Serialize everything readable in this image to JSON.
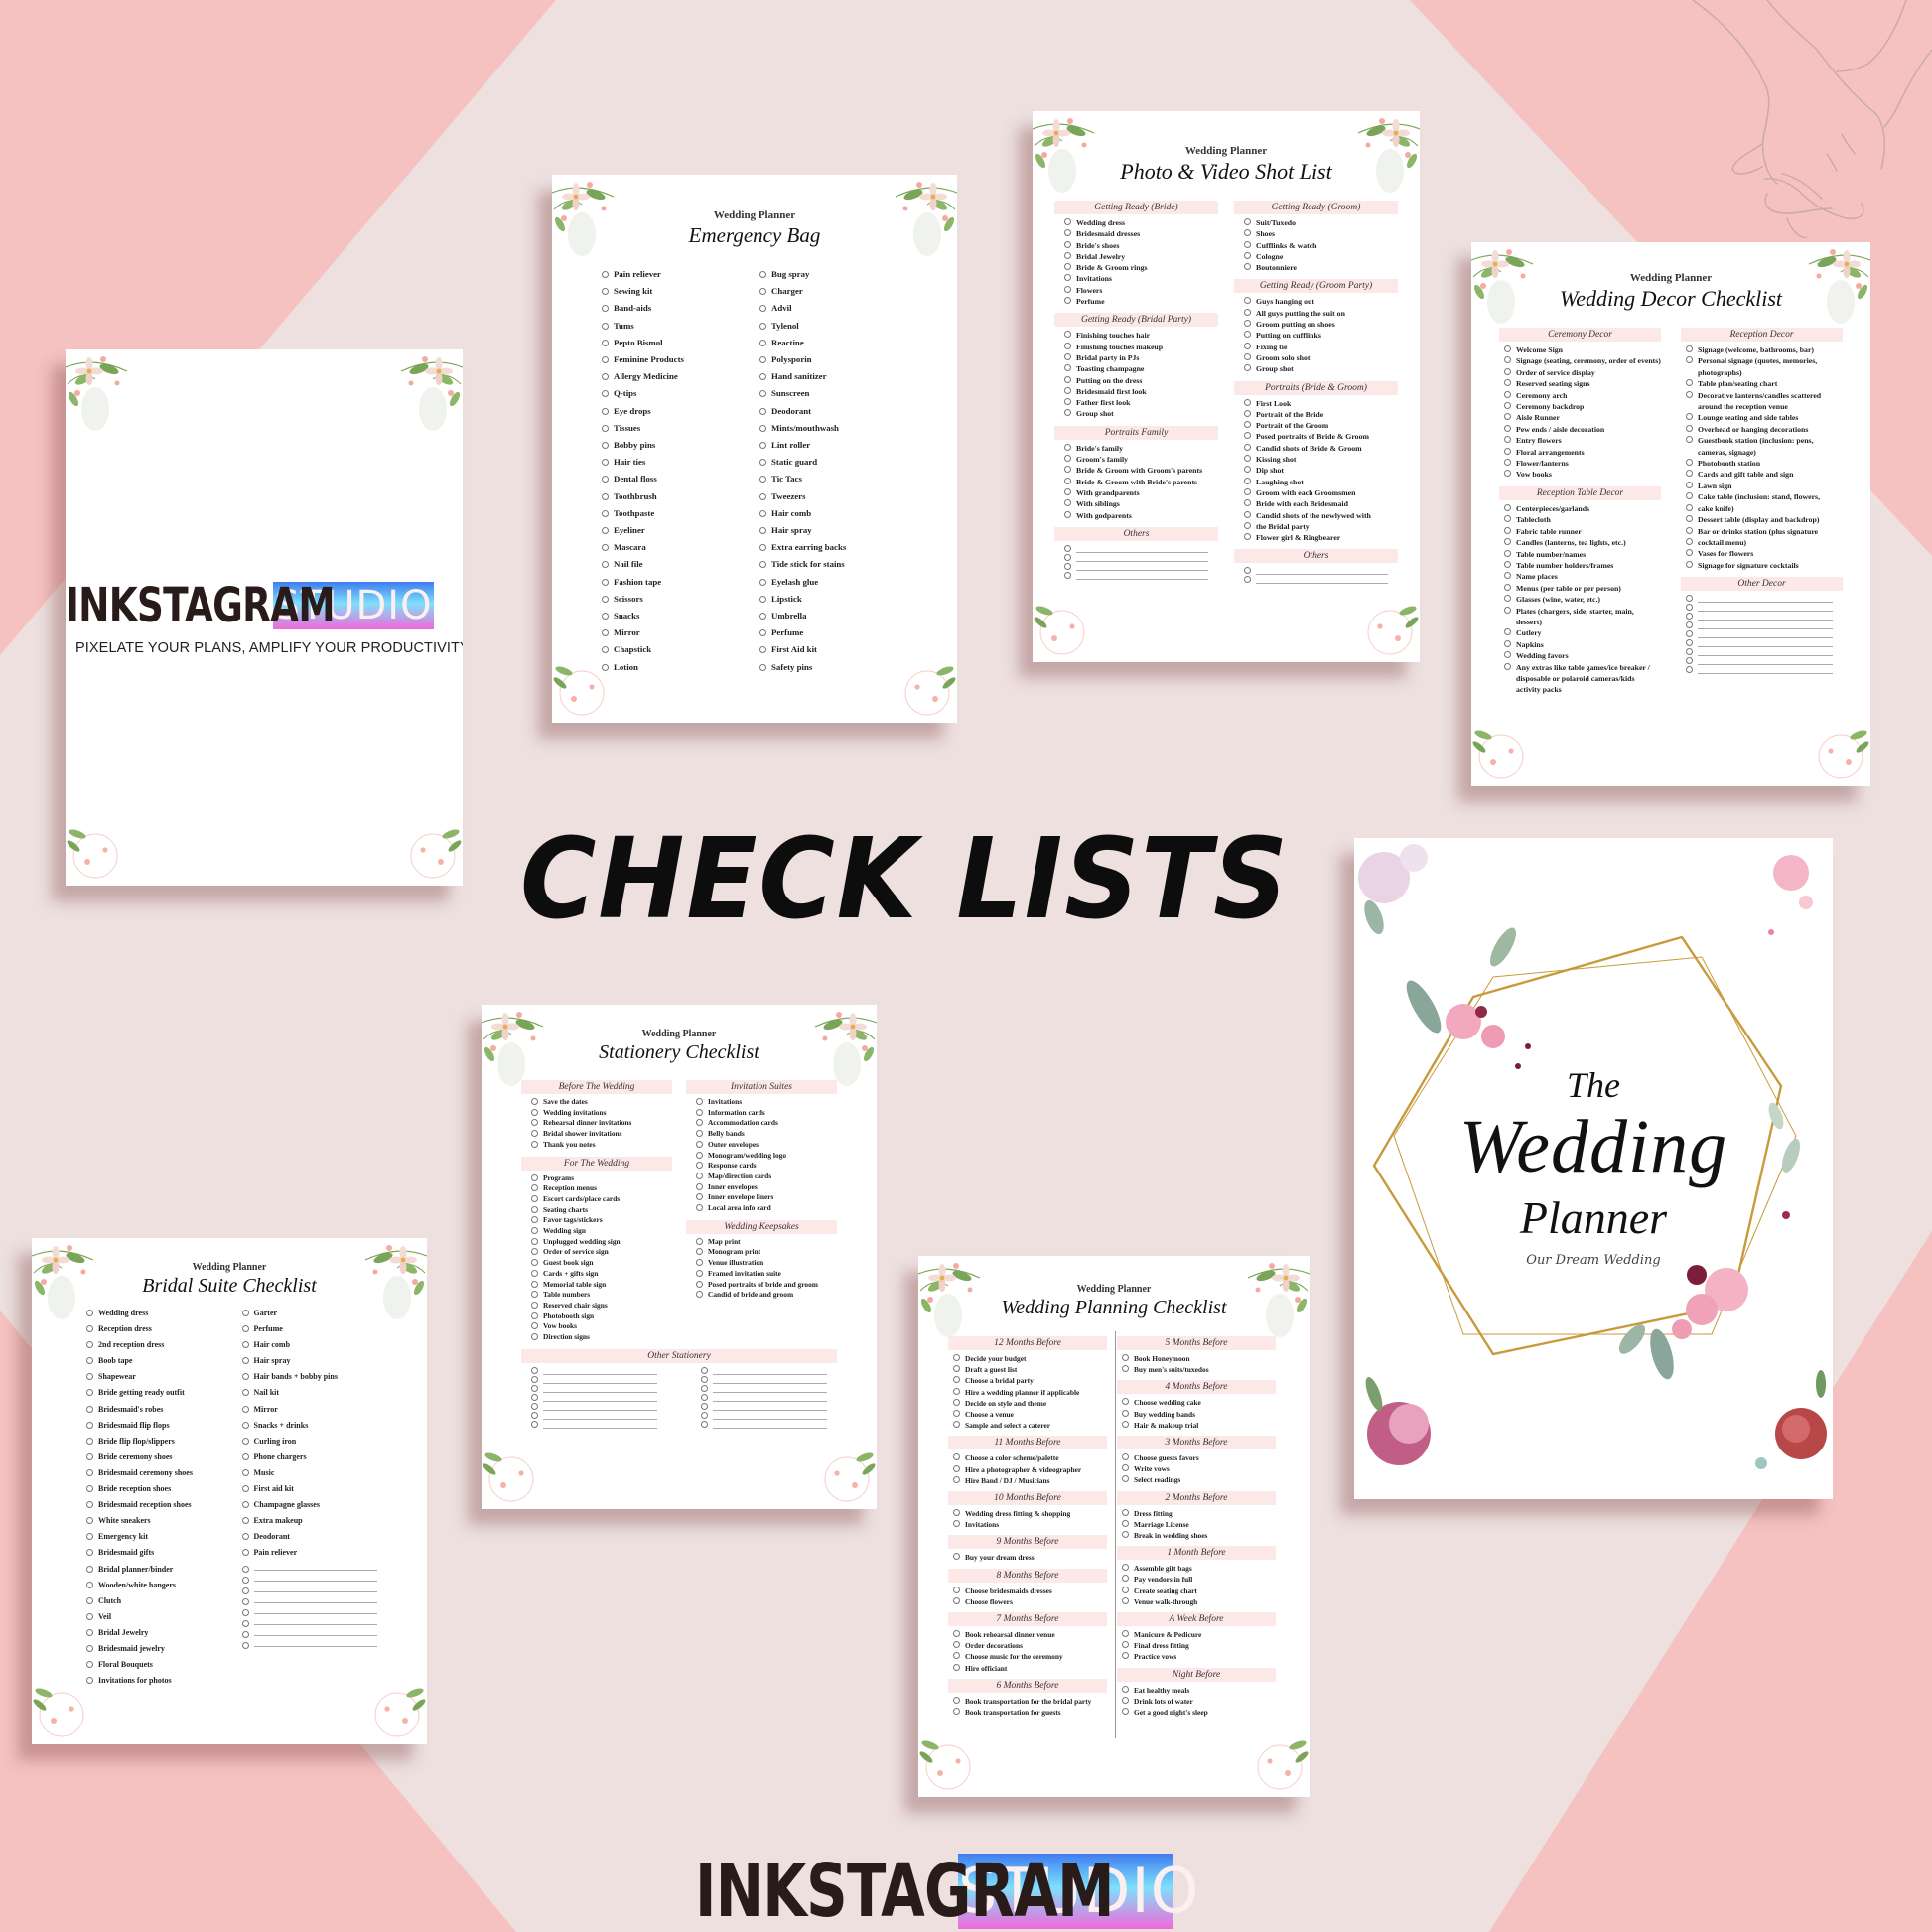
{
  "colors": {
    "background_pink": "#f5c1c1",
    "diamond_blush": "#ede0df",
    "section_header_pink": "#fde8e8",
    "headline": "#0d0d0d",
    "studio_gradient": [
      "#3f7df0",
      "#7ee0fb",
      "#f06ad8"
    ],
    "gold_frame": "#c99a3b"
  },
  "brand": {
    "ink_word": "INKSTAGRAM",
    "studio_word": "STUDIO",
    "tagline": "PIXELATE YOUR PLANS, AMPLIFY YOUR PRODUCTIVITY."
  },
  "headline": "CHECK LISTS",
  "pages": {
    "emergency": {
      "subtitle": "Wedding Planner",
      "title": "Emergency Bag",
      "left": [
        "Pain reliever",
        "Sewing kit",
        "Band-aids",
        "Tums",
        "Pepto Bismol",
        "Feminine Products",
        "Allergy Medicine",
        "Q-tips",
        "Eye drops",
        "Tissues",
        "Bobby pins",
        "Hair ties",
        "Dental floss",
        "Toothbrush",
        "Toothpaste",
        "Eyeliner",
        "Mascara",
        "Nail file",
        "Fashion tape",
        "Scissors",
        "Snacks",
        "Mirror",
        "Chapstick",
        "Lotion"
      ],
      "right": [
        "Bug spray",
        "Charger",
        "Advil",
        "Tylenol",
        "Reactine",
        "Polysporin",
        "Hand sanitizer",
        "Sunscreen",
        "Deodorant",
        "Mints/mouthwash",
        "Lint roller",
        "Static guard",
        "Tic Tacs",
        "Tweezers",
        "Hair comb",
        "Hair spray",
        "Extra earring backs",
        "Tide stick for stains",
        "Eyelash glue",
        "Lipstick",
        "Umbrella",
        "Perfume",
        "First Aid kit",
        "Safety pins"
      ]
    },
    "photo": {
      "subtitle": "Wedding Planner",
      "title": "Photo & Video Shot List",
      "left": [
        {
          "heading": "Getting Ready (Bride)",
          "items": [
            "Wedding dress",
            "Bridesmaid dresses",
            "Bride's shoes",
            "Bridal Jewelry",
            "Bride & Groom rings",
            "Invitations",
            "Flowers",
            "Perfume"
          ]
        },
        {
          "heading": "Getting Ready (Bridal Party)",
          "items": [
            "Finishing touches hair",
            "Finishing touches makeup",
            "Bridal party in PJs",
            "Toasting champagne",
            "Putting on the dress",
            "Bridesmaid first look",
            "Father first look",
            "Group shot"
          ]
        },
        {
          "heading": "Portraits Family",
          "items": [
            "Bride's family",
            "Groom's family",
            "Bride & Groom with Groom's parents",
            "Bride & Groom with Bride's parents",
            "With grandparents",
            "With siblings",
            "With godparents"
          ]
        },
        {
          "heading": "Others",
          "blanks": 4
        }
      ],
      "right": [
        {
          "heading": "Getting Ready (Groom)",
          "items": [
            "Suit/Tuxedo",
            "Shoes",
            "Cufflinks & watch",
            "Cologne",
            "Boutonniere"
          ]
        },
        {
          "heading": "Getting Ready (Groom Party)",
          "items": [
            "Guys hanging out",
            "All guys putting the suit on",
            "Groom putting on shoes",
            "Putting on cufflinks",
            "Fixing tie",
            "Groom solo shot",
            "Group shot"
          ]
        },
        {
          "heading": "Portraits (Bride & Groom)",
          "items": [
            "First Look",
            "Portrait of the Bride",
            "Portrait of the Groom",
            "Posed portraits of Bride & Groom",
            "Candid shots of Bride & Groom",
            "Kissing shot",
            "Dip shot",
            "Laughing shot",
            "Groom with each Groomsmen",
            "Bride with each Bridesmaid",
            "Candid shots of the newlywed with",
            "the Bridal party",
            "Flower girl & Ringbearer"
          ]
        },
        {
          "heading": "Others",
          "blanks": 2
        }
      ]
    },
    "decor": {
      "subtitle": "Wedding Planner",
      "title": "Wedding Decor Checklist",
      "left": [
        {
          "heading": "Ceremony Decor",
          "items": [
            "Welcome Sign",
            "Signage (seating, ceremony, order of events)",
            "Order of service display",
            "Reserved seating signs",
            "Ceremony arch",
            "Ceremony backdrop",
            "Aisle Runner",
            "Pew ends / aisle decoration",
            "Entry flowers",
            "Floral arrangements",
            "Flower/lanterns",
            "Vow books"
          ]
        },
        {
          "heading": "Reception Table Decor",
          "items": [
            "Centerpieces/garlands",
            "Tablecloth",
            "Fabric table runner",
            "Candles (lanterns, tea lights, etc.)",
            "Table number/names",
            "Table number holders/frames",
            "Name places",
            "Menus (per table or per person)",
            "Glasses (wine, water, etc.)",
            "Plates (chargers, side, starter, main, dessert)",
            "Cutlery",
            "Napkins",
            "Wedding favors",
            "Any extras like table games/ice breaker / disposable or polaroid cameras/kids activity packs"
          ]
        }
      ],
      "right": [
        {
          "heading": "Reception Decor",
          "items": [
            "Signage (welcome, bathrooms, bar)",
            "Personal signage (quotes, memories, photographs)",
            "Table plan/seating chart",
            "Decorative lanterns/candles scattered around the reception venue",
            "Lounge seating and side tables",
            "Overhead or hanging decorations",
            "Guestbook station (inclusion: pens, cameras, signage)",
            "Photobooth station",
            "Cards and gift table and sign",
            "Lawn sign",
            "Cake table (inclusion: stand, flowers,",
            "cake knife)",
            "Dessert table (display and backdrop)",
            "Bar or drinks station (plus signature",
            "cocktail menu)",
            "Vases for flowers",
            "Signage for signature cocktails"
          ]
        },
        {
          "heading": "Other Decor",
          "blanks": 9
        }
      ]
    },
    "stationery": {
      "subtitle": "Wedding Planner",
      "title": "Stationery Checklist",
      "left": [
        {
          "heading": "Before The Wedding",
          "items": [
            "Save the dates",
            "Wedding invitations",
            "Rehearsal dinner invitations",
            "Bridal shower invitations",
            "Thank you notes"
          ]
        },
        {
          "heading": "For The Wedding",
          "items": [
            "Programs",
            "Reception menus",
            "Escort cards/place cards",
            "Seating charts",
            "Favor tags/stickers",
            "Wedding sign",
            "Unplugged wedding sign",
            "Order of service sign",
            "Guest book sign",
            "Cards + gifts sign",
            "Memorial table sign",
            "Table numbers",
            "Reserved chair signs",
            "Photobooth sign",
            "Vow books",
            "Direction signs"
          ]
        }
      ],
      "right": [
        {
          "heading": "Invitation Suites",
          "items": [
            "Invitations",
            "Information cards",
            "Accommodation cards",
            "Belly bands",
            "Outer envelopes",
            "Monogram/wedding logo",
            "Response cards",
            "Map/direction cards",
            "Inner envelopes",
            "Inner envelope liners",
            "Local area info card"
          ]
        },
        {
          "heading": "Wedding Keepsakes",
          "items": [
            "Map print",
            "Monogram print",
            "Venue illustration",
            "Framed invitation suite",
            "Posed portraits of bride and groom",
            "Candid of bride and groom"
          ]
        }
      ],
      "other": {
        "heading": "Other Stationery",
        "blanks_per_column": 7
      }
    },
    "bridal": {
      "subtitle": "Wedding Planner",
      "title": "Bridal Suite Checklist",
      "left": [
        "Wedding dress",
        "Reception dress",
        "2nd reception dress",
        "Boob tape",
        "Shapewear",
        "Bride getting ready outfit",
        "Bridesmaid's robes",
        "Bridesmaid flip flops",
        "Bride flip flop/slippers",
        "Bride ceremony shoes",
        "Bridesmaid ceremony shoes",
        "Bride reception shoes",
        "Bridesmaid reception shoes",
        "White sneakers",
        "Emergency kit",
        "Bridesmaid gifts",
        "Bridal planner/binder",
        "Wooden/white hangers",
        "Clutch",
        "Veil",
        "Bridal Jewelry",
        "Bridesmaid jewelry",
        "Floral Bouquets",
        "Invitations for photos"
      ],
      "right": [
        "Garter",
        "Perfume",
        "Hair comb",
        "Hair spray",
        "Hair bands + bobby pins",
        "Nail kit",
        "Mirror",
        "Snacks + drinks",
        "Curling iron",
        "Phone chargers",
        "Music",
        "First aid kit",
        "Champagne glasses",
        "Extra makeup",
        "Deodorant",
        "Pain reliever"
      ],
      "right_blanks": 8
    },
    "planning": {
      "subtitle": "Wedding Planner",
      "title": "Wedding Planning Checklist",
      "left": [
        {
          "heading": "12 Months Before",
          "items": [
            "Decide your budget",
            "Draft a guest list",
            "Choose a bridal party",
            "Hire a wedding planner if applicable",
            "Decide on style and theme",
            "Choose a venue",
            "Sample and select a caterer"
          ]
        },
        {
          "heading": "11 Months Before",
          "items": [
            "Choose a color scheme/palette",
            "Hire a photographer & videographer",
            "Hire Band / DJ / Musicians"
          ]
        },
        {
          "heading": "10 Months Before",
          "items": [
            "Wedding dress fitting & shopping",
            "Invitations"
          ]
        },
        {
          "heading": "9 Months Before",
          "items": [
            "Buy your dream dress"
          ]
        },
        {
          "heading": "8 Months Before",
          "items": [
            "Choose bridesmaids dresses",
            "Choose flowers"
          ]
        },
        {
          "heading": "7 Months Before",
          "items": [
            "Book rehearsal dinner venue",
            "Order decorations",
            "Choose music for the ceremony",
            "Hire officiant"
          ]
        },
        {
          "heading": "6 Months Before",
          "items": [
            "Book transportation for the bridal party",
            "Book transportation for guests"
          ]
        }
      ],
      "right": [
        {
          "heading": "5 Months Before",
          "items": [
            "Book Honeymoon",
            "Buy men's suits/tuxedos"
          ]
        },
        {
          "heading": "4 Months Before",
          "items": [
            "Choose wedding cake",
            "Buy wedding bands",
            "Hair & makeup trial"
          ]
        },
        {
          "heading": "3 Months Before",
          "items": [
            "Choose guests favors",
            "Write vows",
            "Select readings"
          ]
        },
        {
          "heading": "2 Months Before",
          "items": [
            "Dress fitting",
            "Marriage License",
            "Break in wedding shoes"
          ]
        },
        {
          "heading": "1 Month Before",
          "items": [
            "Assemble gift bags",
            "Pay vendors in full",
            "Create seating chart",
            "Venue walk-through"
          ]
        },
        {
          "heading": "A Week Before",
          "items": [
            "Manicure & Pedicure",
            "Final dress fitting",
            "Practice vows"
          ]
        },
        {
          "heading": "Night Before",
          "items": [
            "Eat healthy meals",
            "Drink lots of water",
            "Get a good night's sleep"
          ]
        }
      ]
    },
    "cover": {
      "the": "The",
      "wedding": "Wedding",
      "planner": "Planner",
      "tagline": "Our Dream Wedding"
    }
  }
}
